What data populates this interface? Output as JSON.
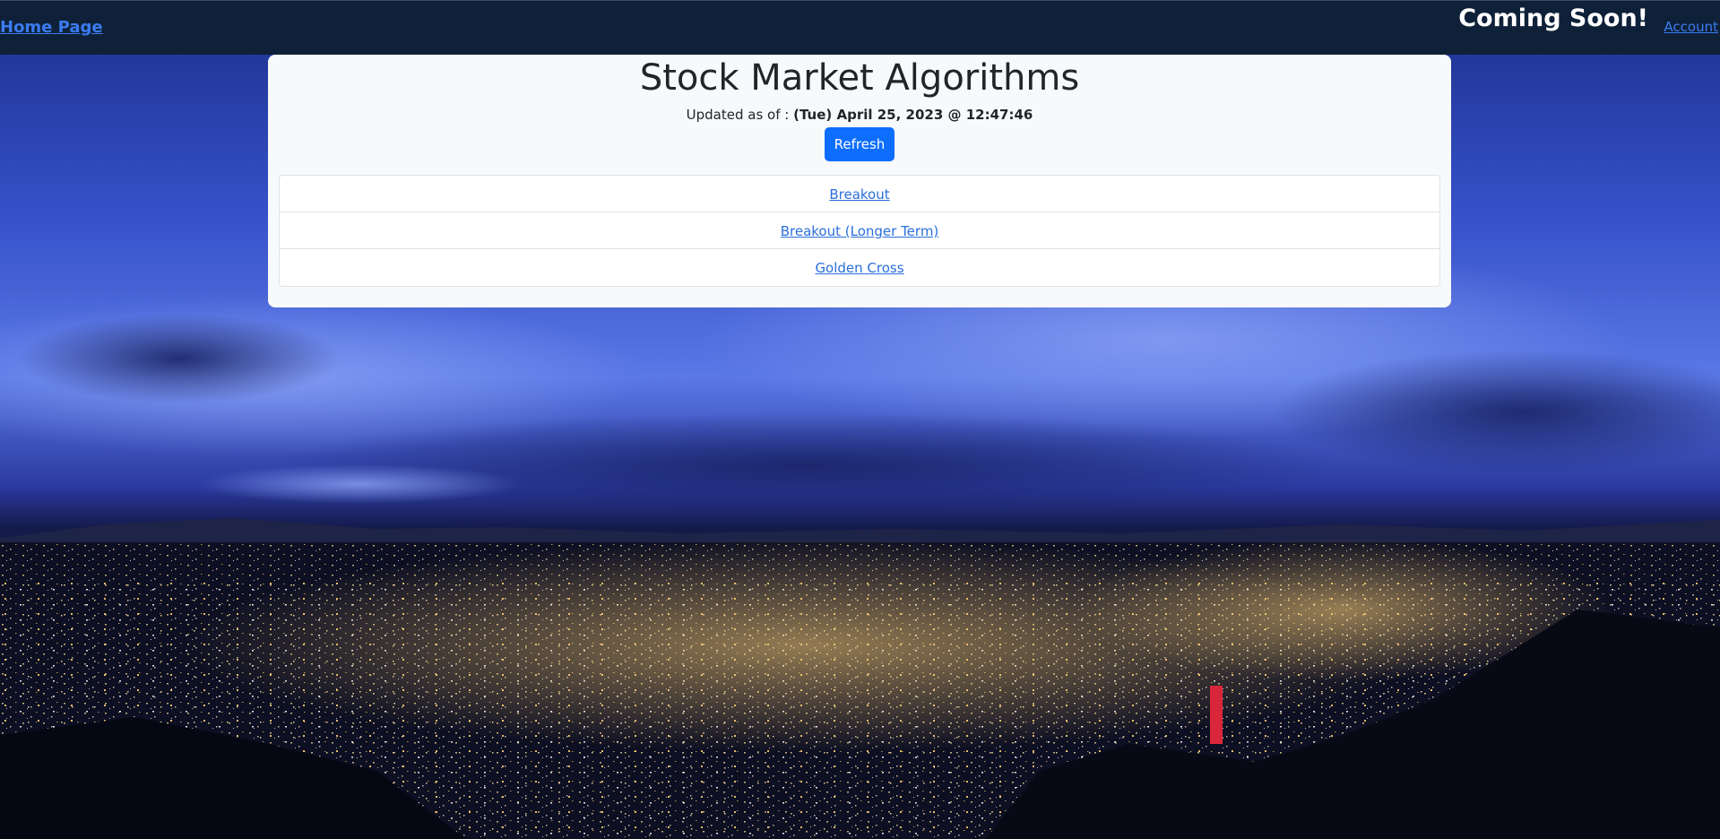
{
  "navbar": {
    "home_label": "Home Page",
    "coming_soon": "Coming Soon!",
    "account_label": "Account"
  },
  "card": {
    "title": "Stock Market Algorithms",
    "updated_prefix": "Updated as of :",
    "updated_value": "(Tue) April 25, 2023 @ 12:47:46",
    "refresh_label": "Refresh",
    "links": [
      {
        "label": "Breakout"
      },
      {
        "label": "Breakout (Longer Term)"
      },
      {
        "label": "Golden Cross"
      }
    ]
  },
  "colors": {
    "navbar_bg": "#0e2139",
    "link": "#3b7bf0",
    "button": "#0d6efd",
    "card_bg": "#f8f9fa"
  },
  "background": {
    "description_icon": "city-night-skyline-photo"
  }
}
